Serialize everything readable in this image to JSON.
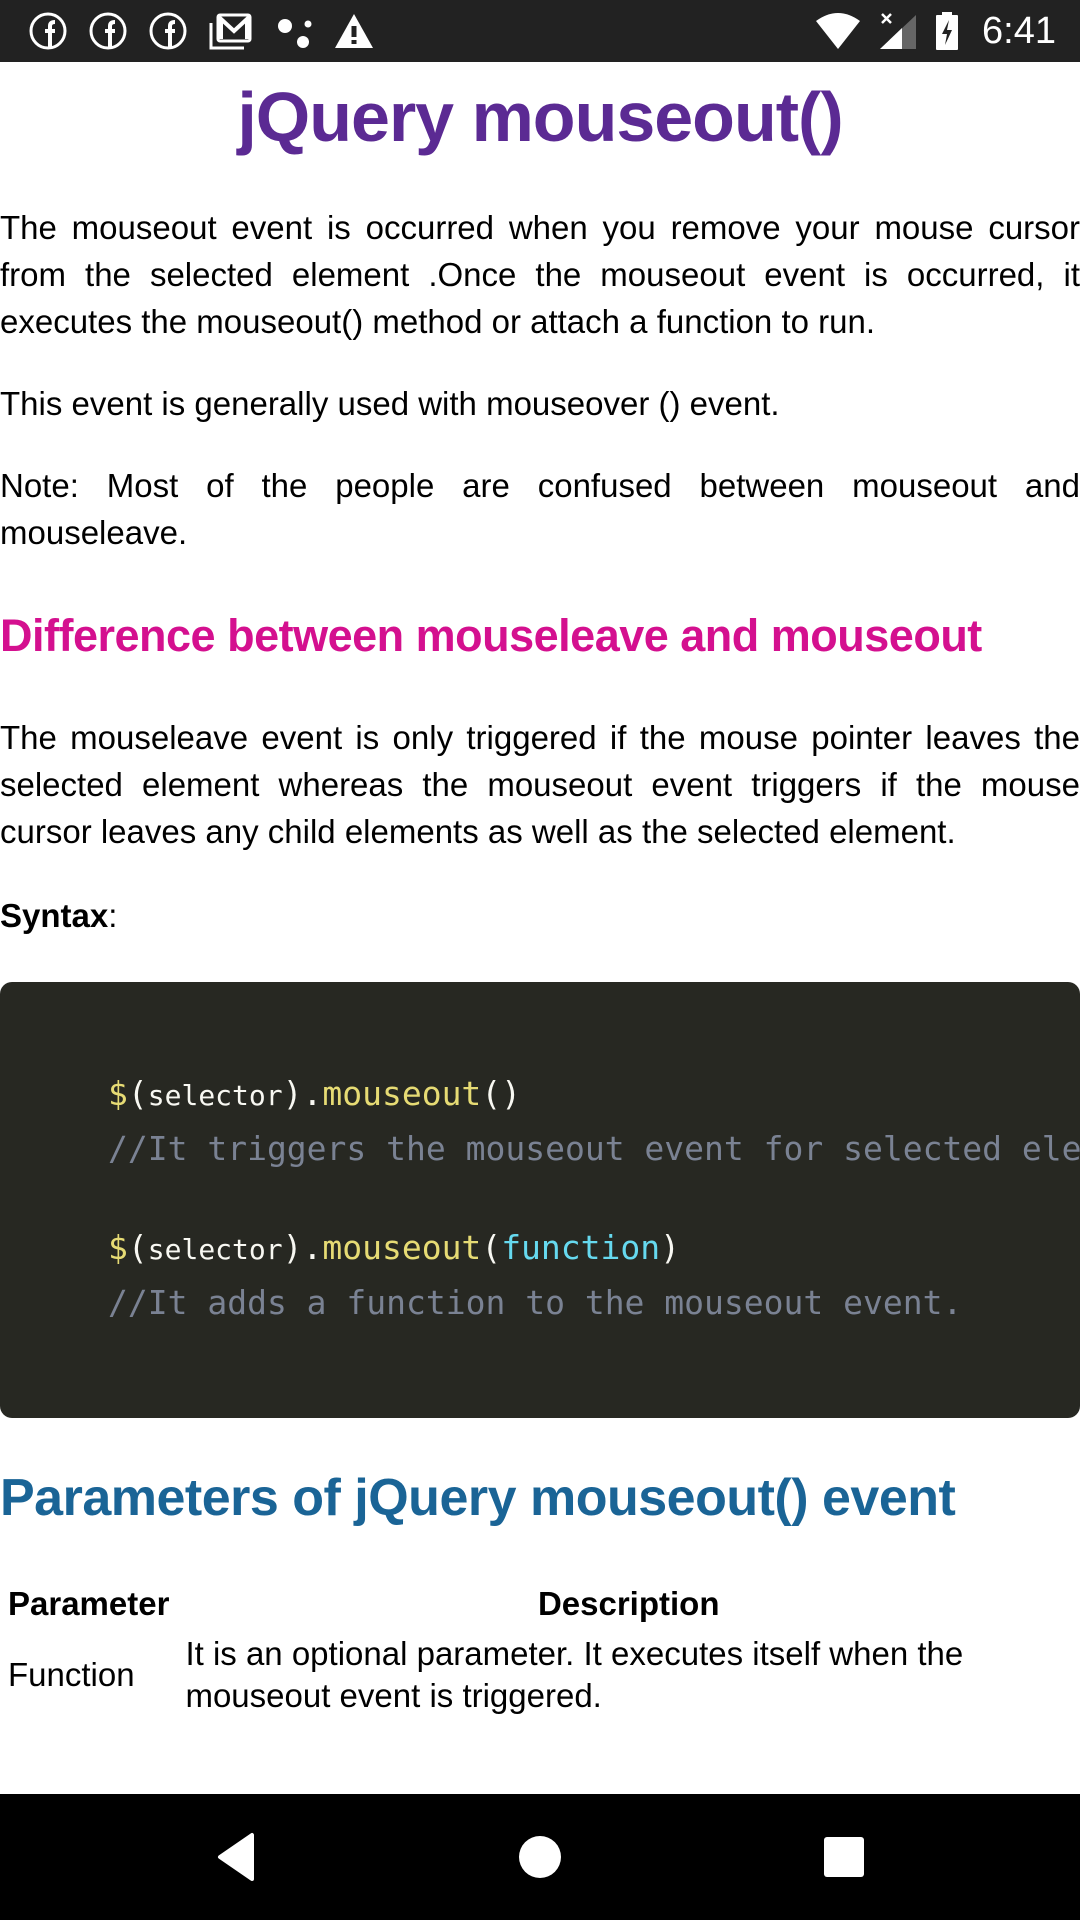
{
  "status_bar": {
    "notification_icons": [
      "facebook-icon",
      "facebook-icon",
      "facebook-icon",
      "gmail-icon",
      "dots-icon",
      "warning-icon"
    ],
    "system_icons": [
      "wifi-icon",
      "signal-no-data-icon",
      "battery-charging-icon"
    ],
    "time": "6:41"
  },
  "article": {
    "title": "jQuery mouseout()",
    "paragraphs": {
      "intro": "The mouseout event is occurred when you remove your mouse cursor from the selected element .Once the mouseout event is occurred, it executes the mouseout() method or attach a function to run.",
      "usage": "This event is generally used with mouseover () event.",
      "note": "Note: Most of the people are confused between mouseout and mouseleave."
    },
    "difference_heading": "Difference between mouseleave and mouseout",
    "difference_text": "The mouseleave event is only triggered if the mouse pointer leaves the selected element whereas the mouseout event triggers if the mouse cursor leaves any child elements as well as the selected element.",
    "syntax_label": "Syntax",
    "syntax_colon": ":",
    "code": {
      "line1": {
        "dollar": "$",
        "open": "(",
        "selector": "selector",
        "close": ").",
        "method": "mouseout",
        "args": "()"
      },
      "comment1": "//It triggers the mouseout event for selected elements.",
      "line2": {
        "dollar": "$",
        "open": "(",
        "selector": "selector",
        "close": ").",
        "method": "mouseout",
        "paren_open": "(",
        "arg": "function",
        "paren_close": ")"
      },
      "comment2": "//It adds a function to the mouseout event."
    },
    "parameters_heading": "Parameters of jQuery mouseout() event",
    "table": {
      "headers": [
        "Parameter",
        "Description"
      ],
      "rows": [
        {
          "parameter": "Function",
          "description": "It is an optional parameter. It executes itself when the mouseout event is triggered."
        }
      ]
    }
  },
  "nav_bar": {
    "buttons": [
      "back",
      "home",
      "recents"
    ]
  },
  "colors": {
    "title": "#5b2a93",
    "difference_heading": "#d4108f",
    "parameters_heading": "#1a6496",
    "code_bg": "#272822"
  }
}
